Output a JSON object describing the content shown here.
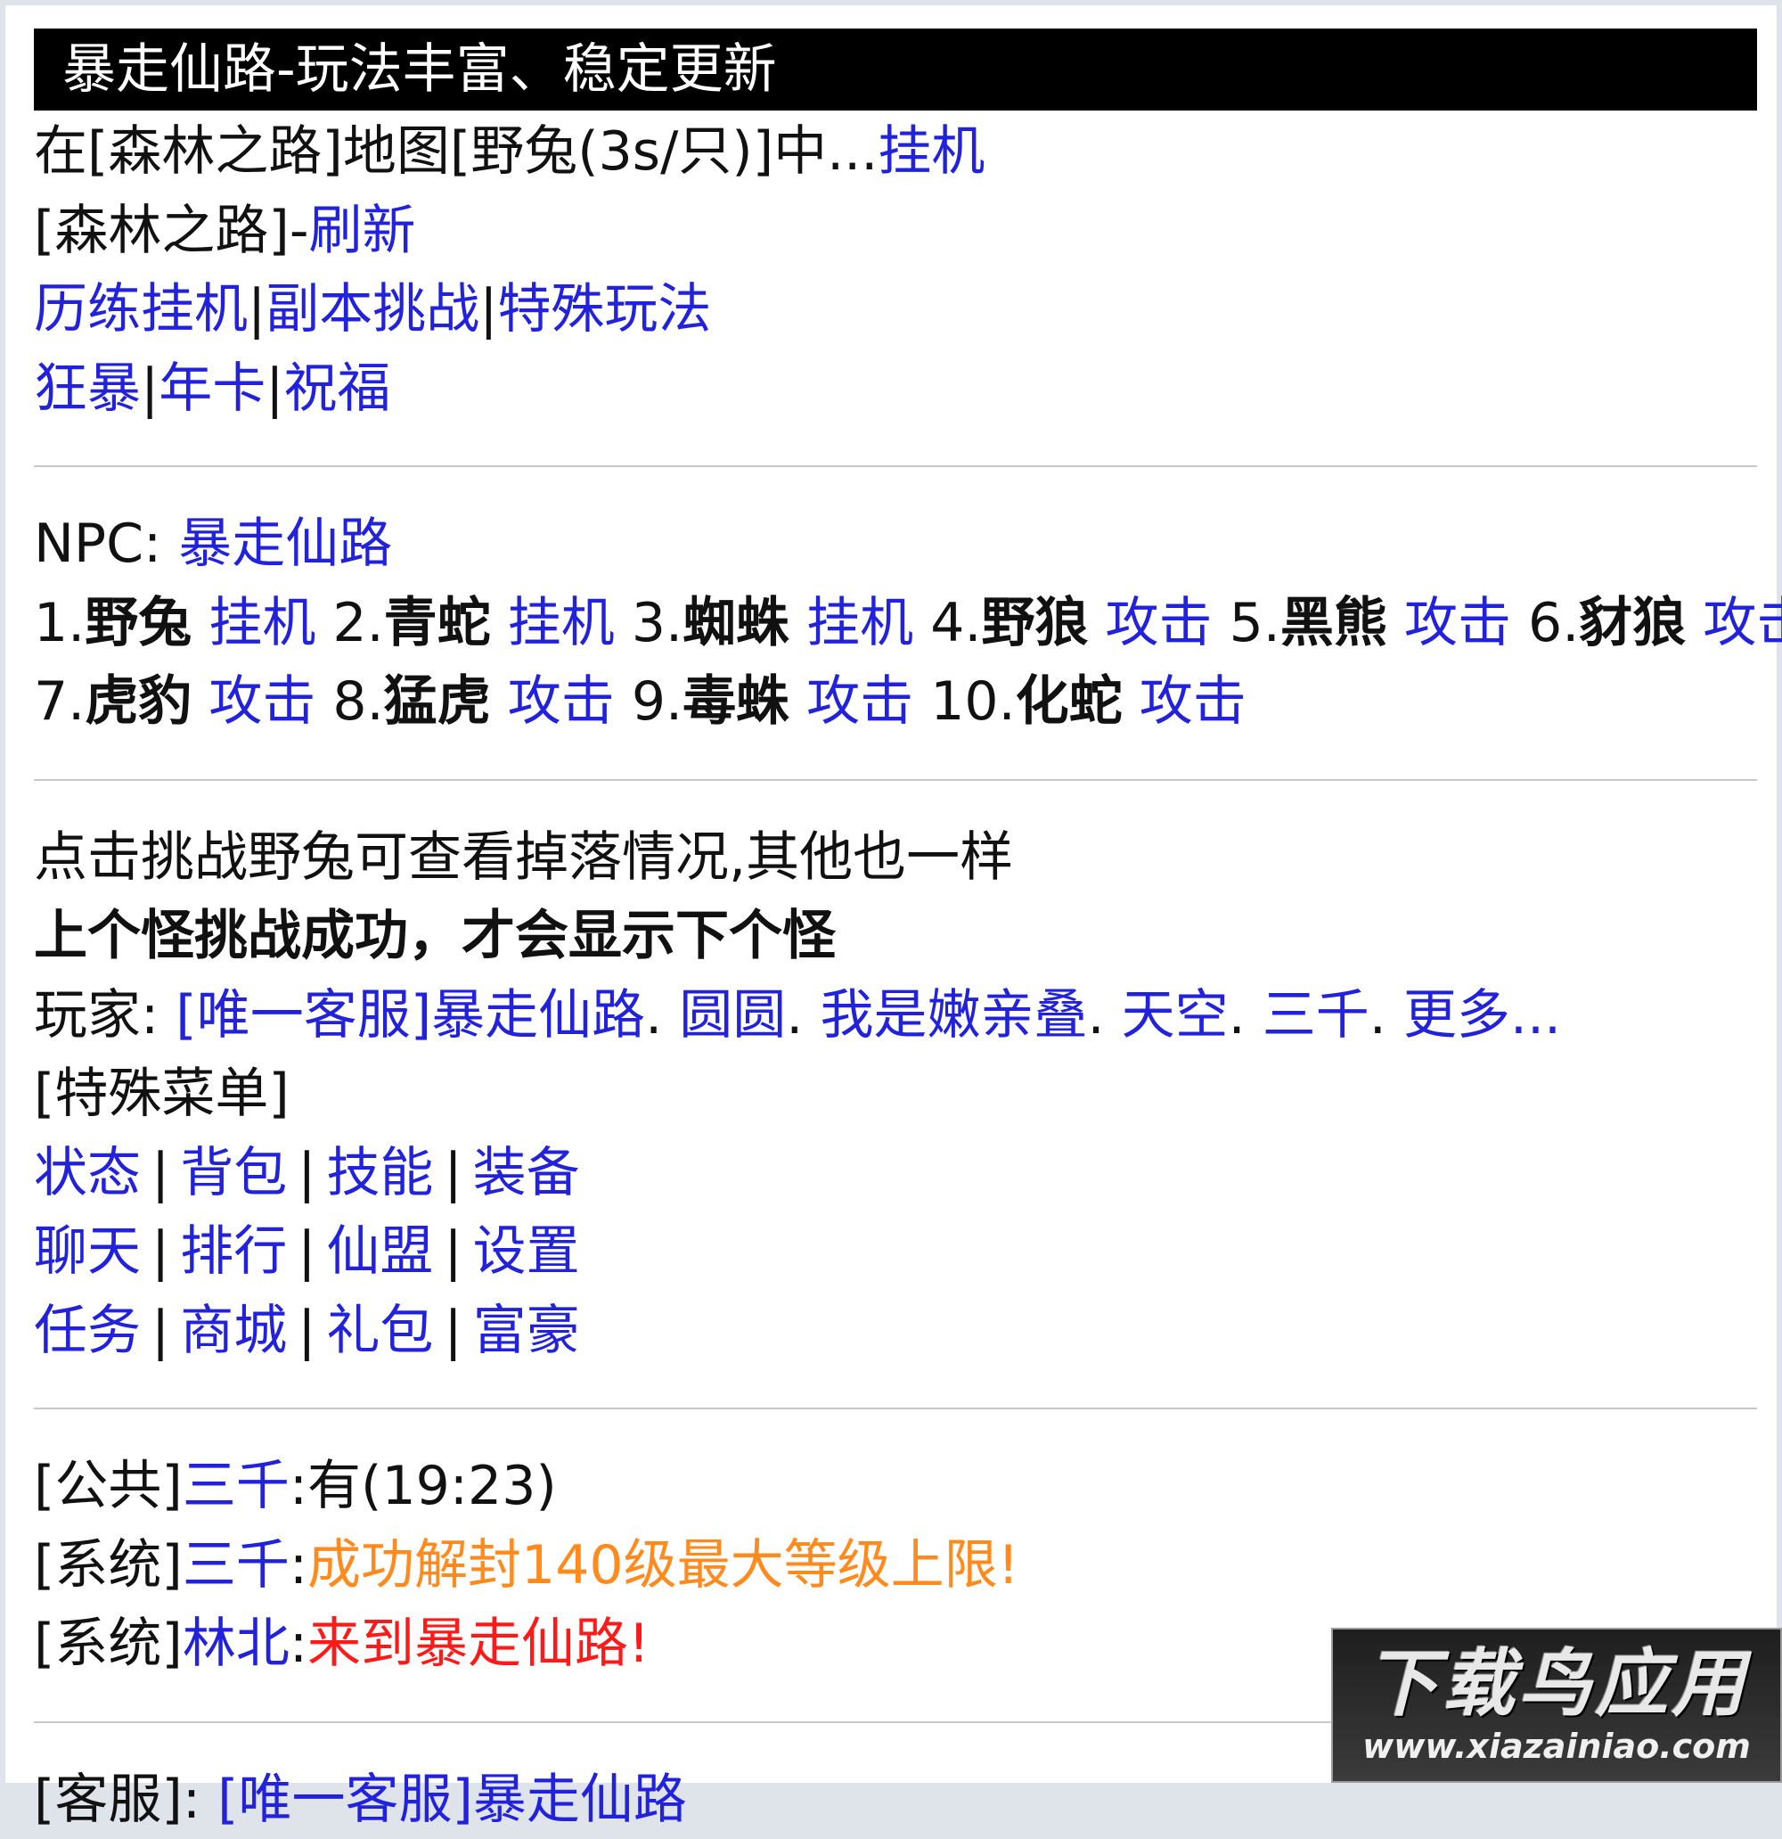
{
  "title": "暴走仙路-玩法丰富、稳定更新",
  "status": {
    "prefix": "在[森林之路]地图[野兔(3s/只)]中...",
    "action": "挂机"
  },
  "map": {
    "name": "[森林之路]-",
    "refresh": "刷新"
  },
  "modes": [
    "历练挂机",
    "副本挑战",
    "特殊玩法"
  ],
  "perks": [
    "狂暴",
    "年卡",
    "祝福"
  ],
  "npc": {
    "label": "NPC: ",
    "name": "暴走仙路"
  },
  "monsters": [
    {
      "num": "1.",
      "name": "野兔",
      "action": "挂机"
    },
    {
      "num": "2.",
      "name": "青蛇",
      "action": "挂机"
    },
    {
      "num": "3.",
      "name": "蜘蛛",
      "action": "挂机"
    },
    {
      "num": "4.",
      "name": "野狼",
      "action": "攻击"
    },
    {
      "num": "5.",
      "name": "黑熊",
      "action": "攻击"
    },
    {
      "num": "6.",
      "name": "豺狼",
      "action": "攻击"
    },
    {
      "num": "7.",
      "name": "虎豹",
      "action": "攻击"
    },
    {
      "num": "8.",
      "name": "猛虎",
      "action": "攻击"
    },
    {
      "num": "9.",
      "name": "毒蛛",
      "action": "攻击"
    },
    {
      "num": "10.",
      "name": "化蛇",
      "action": "攻击"
    }
  ],
  "tip": "点击挑战野兔可查看掉落情况,其他也一样",
  "notice": "上个怪挑战成功，才会显示下个怪",
  "players": {
    "label": "玩家: ",
    "list": [
      "[唯一客服]暴走仙路",
      "圆圆",
      "我是嫩亲叠",
      "天空",
      "三千"
    ],
    "more": "更多..."
  },
  "special_menu": {
    "label": "[特殊菜单]",
    "rows": [
      [
        "状态",
        "背包",
        "技能",
        "装备"
      ],
      [
        "聊天",
        "排行",
        "仙盟",
        "设置"
      ],
      [
        "任务",
        "商城",
        "礼包",
        "富豪"
      ]
    ]
  },
  "chat": [
    {
      "channel": "[公共]",
      "user": "三千",
      "sep": ":",
      "msg": "有(19:23)",
      "color": "#111111"
    },
    {
      "channel": "[系统]",
      "user": "三千",
      "sep": ":",
      "msg": "成功解封140级最大等级上限!",
      "color": "#ff8a1e"
    },
    {
      "channel": "[系统]",
      "user": "林北",
      "sep": ":",
      "msg": "来到暴走仙路!",
      "color": "#ff1a1a"
    }
  ],
  "support": {
    "label": "[客服]:",
    "name": "[唯一客服]暴走仙路"
  },
  "watermark": {
    "big": "下载鸟应用",
    "small": "www.xiazainiao.com"
  }
}
